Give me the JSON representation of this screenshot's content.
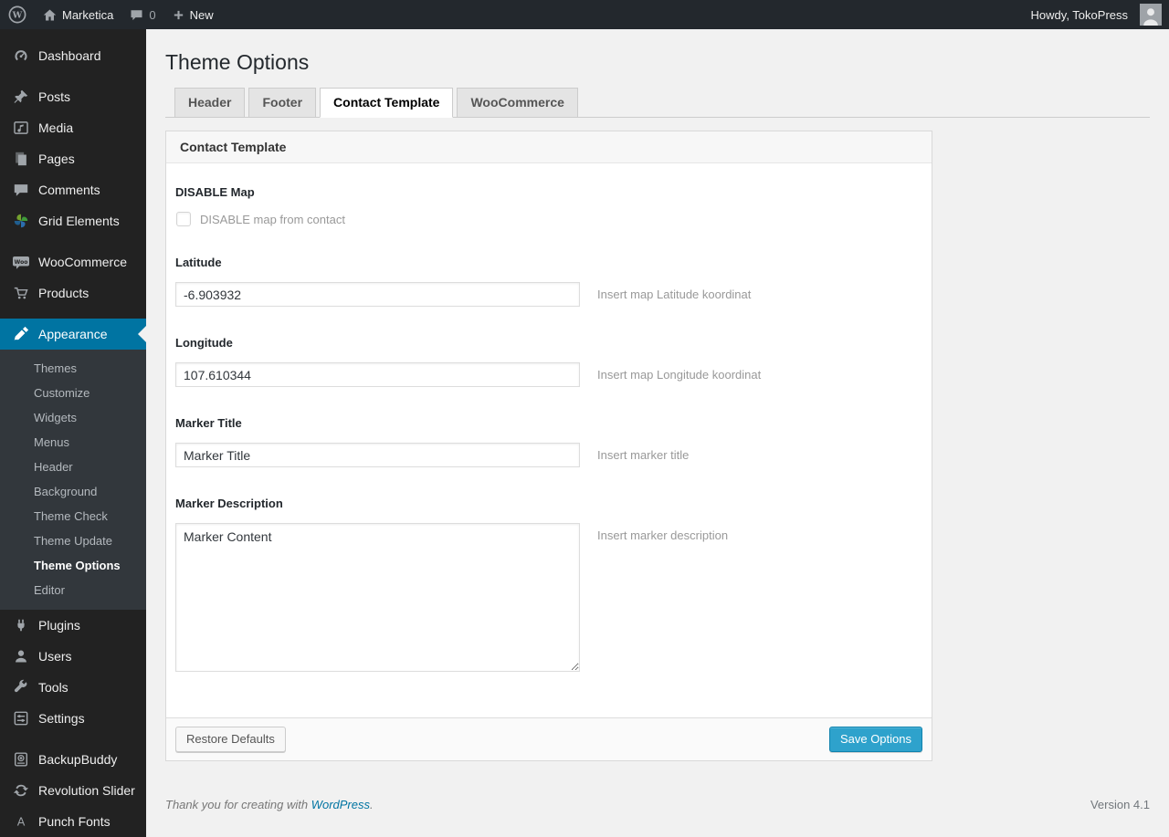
{
  "colors": {
    "accent": "#0074a2",
    "primary_button": "#2ea2cc",
    "content_bg": "#f1f1f1",
    "sidebar_bg": "#222222",
    "active_menu_bg": "#0074a2"
  },
  "admin_bar": {
    "site_name": "Marketica",
    "comment_count": "0",
    "new_label": "New",
    "howdy": "Howdy, TokoPress"
  },
  "sidebar": {
    "menu": [
      {
        "type": "item",
        "label": "Dashboard",
        "icon": "dashboard-icon"
      },
      {
        "type": "gap"
      },
      {
        "type": "item",
        "label": "Posts",
        "icon": "pushpin-icon"
      },
      {
        "type": "item",
        "label": "Media",
        "icon": "media-icon"
      },
      {
        "type": "item",
        "label": "Pages",
        "icon": "pages-icon"
      },
      {
        "type": "item",
        "label": "Comments",
        "icon": "comments-icon"
      },
      {
        "type": "item",
        "label": "Grid Elements",
        "icon": "grid-elements-icon"
      },
      {
        "type": "gap"
      },
      {
        "type": "item",
        "label": "WooCommerce",
        "icon": "woocommerce-icon"
      },
      {
        "type": "item",
        "label": "Products",
        "icon": "cart-icon"
      },
      {
        "type": "gap"
      },
      {
        "type": "item",
        "label": "Appearance",
        "icon": "paintbrush-icon",
        "active": true
      },
      {
        "type": "submenu",
        "items": [
          {
            "label": "Themes"
          },
          {
            "label": "Customize"
          },
          {
            "label": "Widgets"
          },
          {
            "label": "Menus"
          },
          {
            "label": "Header"
          },
          {
            "label": "Background"
          },
          {
            "label": "Theme Check"
          },
          {
            "label": "Theme Update"
          },
          {
            "label": "Theme Options",
            "current": true
          },
          {
            "label": "Editor"
          }
        ]
      },
      {
        "type": "item",
        "label": "Plugins",
        "icon": "plug-icon"
      },
      {
        "type": "item",
        "label": "Users",
        "icon": "user-icon"
      },
      {
        "type": "item",
        "label": "Tools",
        "icon": "wrench-icon"
      },
      {
        "type": "item",
        "label": "Settings",
        "icon": "settings-icon"
      },
      {
        "type": "gap"
      },
      {
        "type": "item",
        "label": "BackupBuddy",
        "icon": "backupbuddy-icon"
      },
      {
        "type": "item",
        "label": "Revolution Slider",
        "icon": "revolution-slider-icon"
      },
      {
        "type": "item",
        "label": "Punch Fonts",
        "icon": "punch-fonts-icon"
      }
    ]
  },
  "page": {
    "title": "Theme Options"
  },
  "tabs": [
    {
      "label": "Header"
    },
    {
      "label": "Footer"
    },
    {
      "label": "Contact Template",
      "active": true
    },
    {
      "label": "WooCommerce"
    }
  ],
  "panel": {
    "title": "Contact Template"
  },
  "fields": [
    {
      "type": "checkbox",
      "label": "DISABLE Map",
      "checkbox_label": "DISABLE map from contact",
      "checked": false
    },
    {
      "type": "text",
      "label": "Latitude",
      "value": "-6.903932",
      "desc": "Insert map Latitude koordinat"
    },
    {
      "type": "text",
      "label": "Longitude",
      "value": "107.610344",
      "desc": "Insert map Longitude koordinat"
    },
    {
      "type": "text",
      "label": "Marker Title",
      "value": "Marker Title",
      "desc": "Insert marker title"
    },
    {
      "type": "textarea",
      "label": "Marker Description",
      "value": "Marker Content",
      "desc": "Insert marker description"
    }
  ],
  "actions": {
    "restore_label": "Restore Defaults",
    "save_label": "Save Options"
  },
  "footer": {
    "thanks_prefix": "Thank you for creating with",
    "wordpress_link": "WordPress",
    "thanks_suffix": ".",
    "version": "Version 4.1"
  }
}
